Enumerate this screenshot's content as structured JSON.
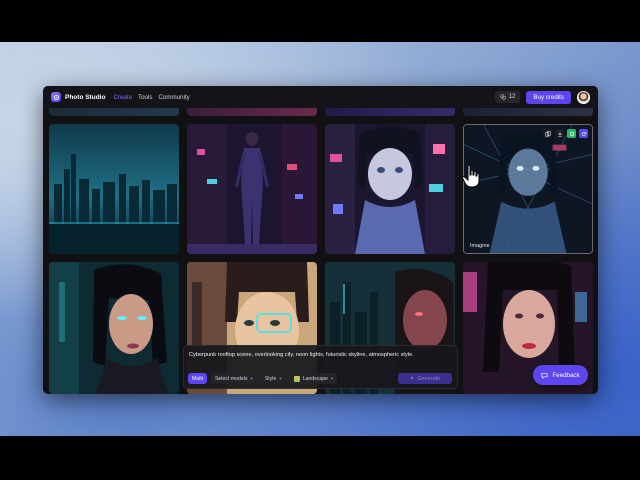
{
  "app": {
    "title": "Photo Studio",
    "accent_color": "#5b46f0",
    "nav": [
      {
        "label": "Create",
        "active": true
      },
      {
        "label": "Tools",
        "active": false
      },
      {
        "label": "Community",
        "active": false
      }
    ]
  },
  "header": {
    "credits_count": "12",
    "buy_credits_label": "Buy credits",
    "avatar_icon": "user-avatar"
  },
  "gallery": {
    "tiles": [
      {
        "name": "tile-city-skyline",
        "label": ""
      },
      {
        "name": "tile-cyber-woman-full-body",
        "label": ""
      },
      {
        "name": "tile-anime-girl-neon",
        "label": ""
      },
      {
        "name": "tile-holographic-woman",
        "label": "Imagine",
        "hovered": true,
        "actions": [
          "copy-icon",
          "download-icon",
          "upscale-icon",
          "refresh-icon"
        ]
      },
      {
        "name": "tile-cyber-woman-glowing-eyes",
        "label": ""
      },
      {
        "name": "tile-comic-hud-girl",
        "label": ""
      },
      {
        "name": "tile-skyline-face",
        "label": ""
      },
      {
        "name": "tile-neon-portrait",
        "label": ""
      }
    ]
  },
  "prompt": {
    "text": "Cyberpunk rooftop scene, overlooking city, neon lights, futuristic skyline, atmospheric style.",
    "mode_label": "Multi",
    "model_select": "Select models",
    "style_select": "Style",
    "aspect_select": "Landscape",
    "generate_label": "Generate"
  },
  "feedback": {
    "label": "Feedback"
  }
}
